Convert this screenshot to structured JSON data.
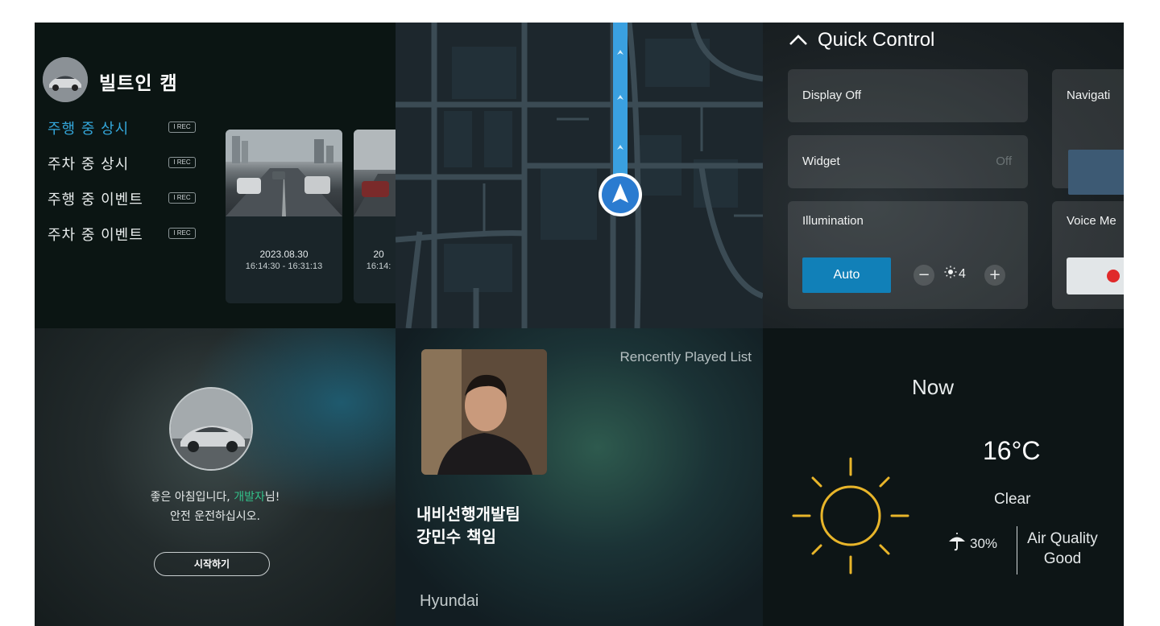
{
  "colors": {
    "accent_blue": "#34a8dc",
    "auto_button": "#1180b8",
    "highlight_green": "#33c28a",
    "sun_yellow": "#e8b52a",
    "route_blue": "#3aa0e0",
    "record_red": "#e02a2a"
  },
  "cam": {
    "title": "빌트인 캠",
    "modes": [
      {
        "label": "주행 중 상시",
        "badge": "I REC",
        "active": true
      },
      {
        "label": "주차 중 상시",
        "badge": "I REC",
        "active": false
      },
      {
        "label": "주행 중 이벤트",
        "badge": "I REC",
        "active": false
      },
      {
        "label": "주차 중 이벤트",
        "badge": "I REC",
        "active": false
      }
    ],
    "clips": [
      {
        "date": "2023.08.30",
        "time": "16:14:30 - 16:31:13"
      },
      {
        "date": "20",
        "time": "16:14:"
      }
    ]
  },
  "map": {
    "position_icon": "navigation-arrow-icon",
    "route_icon": "route-chevron-icon"
  },
  "quick_control": {
    "header": "Quick Control",
    "display_off": "Display Off",
    "widget": {
      "label": "Widget",
      "value": "Off"
    },
    "illumination": {
      "label": "Illumination",
      "auto": "Auto",
      "level": "4"
    },
    "navigation": "Navigati",
    "voice_memo": "Voice Me"
  },
  "greeting": {
    "line1_prefix": "좋은 아침입니다, ",
    "name": "개발자",
    "line1_suffix": "님!",
    "line2": "안전 운전하십시오.",
    "start_button": "시작하기"
  },
  "music": {
    "recent_label": "Rencently Played List",
    "title_line1": "내비선행개발팀",
    "title_line2": "강민수 책임",
    "artist": "Hyundai"
  },
  "weather": {
    "now": "Now",
    "temperature": "16°C",
    "condition": "Clear",
    "rain_chance": "30%",
    "air_quality_label": "Air Quality",
    "air_quality_value": "Good",
    "icon": "sun-icon"
  }
}
